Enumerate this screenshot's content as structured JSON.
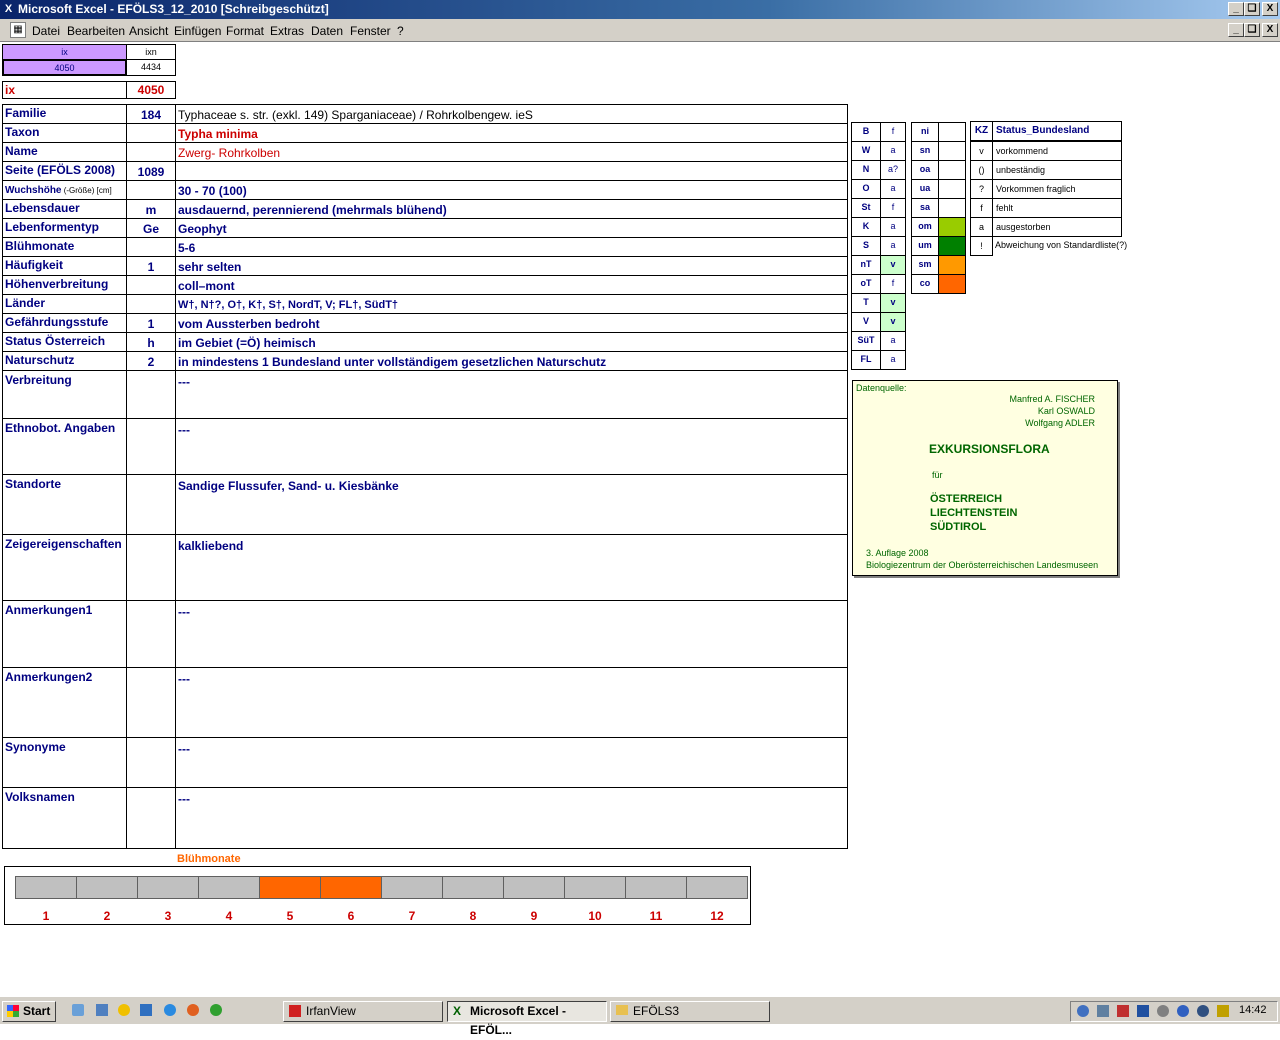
{
  "window": {
    "title": "Microsoft Excel - EFÖLS3_12_2010  [Schreibgeschützt]",
    "controls": [
      "_",
      "❏",
      "X"
    ]
  },
  "menu": [
    "Datei",
    "Bearbeiten",
    "Ansicht",
    "Einfügen",
    "Format",
    "Extras",
    "Daten",
    "Fenster",
    "?"
  ],
  "index": {
    "ix_label": "ix",
    "ix_value": "4050",
    "ixn_label": "ixn",
    "ixn_value": "4434",
    "ix2_label": "ix",
    "ix2_value": "4050"
  },
  "rows": [
    {
      "label": "Familie",
      "code": "184",
      "value": "Typhaceae s. str. (exkl. 149) Sparganiaceae)  /  Rohrkolbengew. ieS"
    },
    {
      "label": "Taxon",
      "code": "",
      "value": "Typha minima"
    },
    {
      "label": "Name",
      "code": "",
      "value": "Zwerg- Rohrkolben"
    },
    {
      "label": "Seite (EFÖLS 2008)",
      "code": "1089",
      "value": ""
    },
    {
      "label": "Wuchshöhe",
      "label_suffix": " (-Größe) [cm]",
      "code": "",
      "value": " 30 - 70 (100)"
    },
    {
      "label": "Lebensdauer",
      "code": "m",
      "value": "ausdauernd, perennierend (mehrmals blühend)"
    },
    {
      "label": "Lebenformentyp",
      "code": "Ge",
      "value": "Geophyt"
    },
    {
      "label": "Blühmonate",
      "code": "",
      "value": " 5-6"
    },
    {
      "label": "Häufigkeit",
      "code": "1",
      "value": "sehr selten"
    },
    {
      "label": "Höhenverbreitung",
      "code": "",
      "value": "coll–mont"
    },
    {
      "label": "Länder",
      "code": "",
      "value": "W†, N†?, O†, K†, S†, NordT, V; FL†, SüdT†"
    },
    {
      "label": "Gefährdungsstufe",
      "code": "1",
      "value": "vom Aussterben bedroht"
    },
    {
      "label": "Status Österreich",
      "code": "h",
      "value": "im Gebiet (=Ö) heimisch"
    },
    {
      "label": "Naturschutz",
      "code": "2",
      "value": "in mindestens 1 Bundesland unter vollständigem gesetzlichen Naturschutz"
    }
  ],
  "big_rows": [
    {
      "label": "Verbreitung",
      "value": "---"
    },
    {
      "label": "Ethnobot. Angaben",
      "value": "---"
    },
    {
      "label": "Standorte",
      "value": "Sandige Flussufer, Sand- u. Kiesbänke"
    },
    {
      "label": "Zeigereigenschaften",
      "value": "kalkliebend"
    },
    {
      "label": "Anmerkungen1",
      "value": "---"
    },
    {
      "label": "Anmerkungen2",
      "value": "---"
    },
    {
      "label": "Synonyme",
      "value": "---"
    },
    {
      "label": "Volksnamen",
      "value": "---"
    }
  ],
  "regions": [
    {
      "code": "B",
      "status": "f"
    },
    {
      "code": "W",
      "status": "a"
    },
    {
      "code": "N",
      "status": "a?"
    },
    {
      "code": "O",
      "status": "a"
    },
    {
      "code": "St",
      "status": "f"
    },
    {
      "code": "K",
      "status": "a"
    },
    {
      "code": "S",
      "status": "a"
    },
    {
      "code": "nT",
      "status": "v"
    },
    {
      "code": "oT",
      "status": "f"
    },
    {
      "code": "T",
      "status": "v"
    },
    {
      "code": "V",
      "status": "v"
    },
    {
      "code": "SüT",
      "status": "a"
    },
    {
      "code": "FL",
      "status": "a"
    }
  ],
  "altitude": [
    {
      "code": "ni",
      "color": ""
    },
    {
      "code": "sn",
      "color": ""
    },
    {
      "code": "oa",
      "color": ""
    },
    {
      "code": "ua",
      "color": ""
    },
    {
      "code": "sa",
      "color": ""
    },
    {
      "code": "om",
      "color": "#99cc00"
    },
    {
      "code": "um",
      "color": "#008000"
    },
    {
      "code": "sm",
      "color": "#ff9900"
    },
    {
      "code": "co",
      "color": "#ff6600"
    }
  ],
  "status_legend": {
    "header_kz": "KZ",
    "header_title": "Status_Bundesland",
    "items": [
      {
        "kz": "v",
        "text": "vorkommend"
      },
      {
        "kz": "()",
        "text": "unbeständig"
      },
      {
        "kz": "?",
        "text": "Vorkommen fraglich"
      },
      {
        "kz": "f",
        "text": "fehlt"
      },
      {
        "kz": "a",
        "text": "ausgestorben"
      },
      {
        "kz": "!",
        "text": "Abweichung von Standardliste(?)"
      }
    ]
  },
  "source": {
    "label": "Datenquelle:",
    "authors": [
      "Manfred A. FISCHER",
      "Karl OSWALD",
      "Wolfgang ADLER"
    ],
    "title": "EXKURSIONSFLORA",
    "fuer": "für",
    "countries": [
      "ÖSTERREICH",
      "LIECHTENSTEIN",
      "SÜDTIROL"
    ],
    "edition": "3. Auflage 2008",
    "publisher": "Biologiezentrum der Oberösterreichischen Landesmuseen"
  },
  "chart_data": {
    "type": "bar",
    "title": "Blühmonate",
    "categories": [
      "1",
      "2",
      "3",
      "4",
      "5",
      "6",
      "7",
      "8",
      "9",
      "10",
      "11",
      "12"
    ],
    "values": [
      0,
      0,
      0,
      0,
      1,
      1,
      0,
      0,
      0,
      0,
      0,
      0
    ],
    "colors": {
      "on": "#ff6600",
      "off": "#c0c0c0"
    }
  },
  "taskbar": {
    "start": "Start",
    "tasks": [
      {
        "label": "IrfanView",
        "active": false
      },
      {
        "label": "Microsoft Excel - EFÖL...",
        "active": true
      },
      {
        "label": "EFÖLS3",
        "active": false
      }
    ],
    "clock": "14:42"
  }
}
